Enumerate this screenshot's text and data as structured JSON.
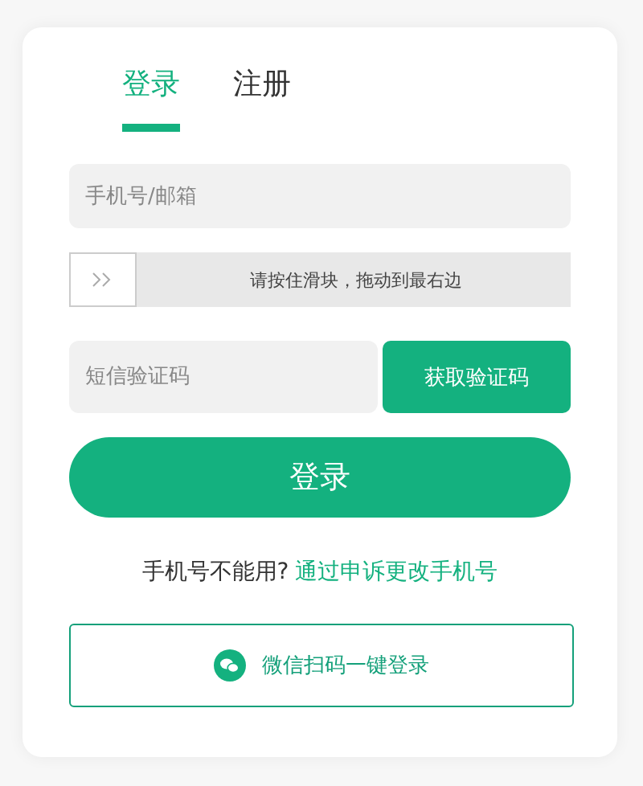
{
  "tabs": [
    {
      "label": "登录",
      "selected": true
    },
    {
      "label": "注册",
      "selected": false
    }
  ],
  "account_field": {
    "placeholder": "手机号/邮箱"
  },
  "slider": {
    "hint": "请按住滑块，拖动到最右边",
    "level": 0
  },
  "code_field": {
    "placeholder": "短信验证码"
  },
  "get_code_button": "获取验证码",
  "login_button": "登录",
  "help": {
    "text": "手机号不能用?",
    "link": "通过申诉更改手机号"
  },
  "wechat_button": "微信扫码一键登录"
}
